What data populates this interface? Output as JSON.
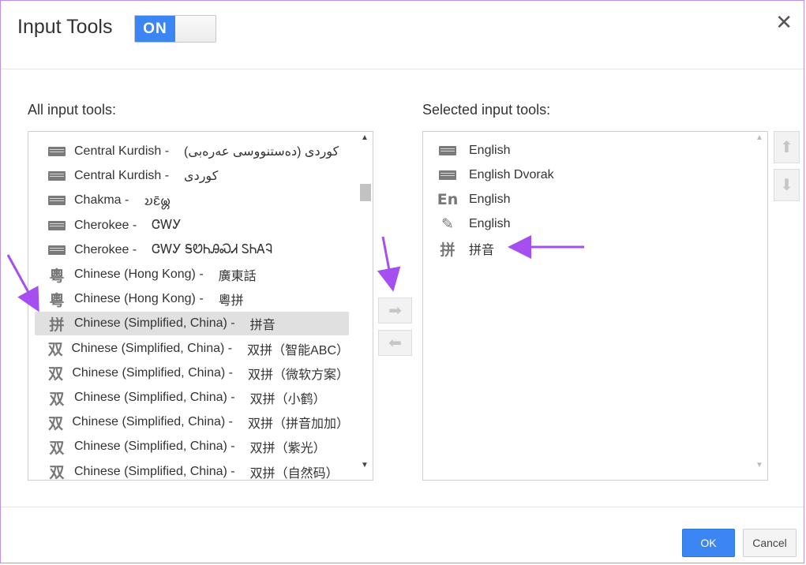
{
  "dialog": {
    "title": "Input Tools",
    "toggle_label": "ON",
    "close_glyph": "✕"
  },
  "left": {
    "label": "All input tools:",
    "items": [
      {
        "icon": "keyboard-icon",
        "name": "Central Kurdish -",
        "native": "کوردی (دەستنووسی عەرەبی)"
      },
      {
        "icon": "keyboard-icon",
        "name": "Central Kurdish -",
        "native": "کوردی"
      },
      {
        "icon": "keyboard-icon",
        "name": "Chakma -",
        "native": "𑄌𑄋𑄴𑄟𑄳𑄦"
      },
      {
        "icon": "keyboard-icon",
        "name": "Cherokee -",
        "native": "ᏣᎳᎩ"
      },
      {
        "icon": "keyboard-icon",
        "name": "Cherokee -",
        "native": "ᏣᎳᎩ ᎦᏬᏂᎯᏍᏗ ᏚᏂᎪᎸ"
      },
      {
        "icon": "yue-icon",
        "glyph": "粵",
        "name": "Chinese (Hong Kong) -",
        "native": "廣東話"
      },
      {
        "icon": "yue-icon",
        "glyph": "粵",
        "name": "Chinese (Hong Kong) -",
        "native": "粵拼"
      },
      {
        "icon": "pinyin-icon",
        "glyph": "拼",
        "name": "Chinese (Simplified, China) -",
        "native": "拼音",
        "selected": true
      },
      {
        "icon": "shuangpin-icon",
        "glyph": "双",
        "name": "Chinese (Simplified, China) -",
        "native": "双拼（智能ABC）"
      },
      {
        "icon": "shuangpin-icon",
        "glyph": "双",
        "name": "Chinese (Simplified, China) -",
        "native": "双拼（微软方案）"
      },
      {
        "icon": "shuangpin-icon",
        "glyph": "双",
        "name": "Chinese (Simplified, China) -",
        "native": "双拼（小鹤）"
      },
      {
        "icon": "shuangpin-icon",
        "glyph": "双",
        "name": "Chinese (Simplified, China) -",
        "native": "双拼（拼音加加）"
      },
      {
        "icon": "shuangpin-icon",
        "glyph": "双",
        "name": "Chinese (Simplified, China) -",
        "native": "双拼（紫光）"
      },
      {
        "icon": "shuangpin-icon",
        "glyph": "双",
        "name": "Chinese (Simplified, China) -",
        "native": "双拼（自然码）"
      }
    ]
  },
  "right": {
    "label": "Selected input tools:",
    "items": [
      {
        "icon": "keyboard-icon",
        "name": "English"
      },
      {
        "icon": "keyboard-icon",
        "name": "English Dvorak"
      },
      {
        "icon": "transliteration-icon",
        "glyph": "En",
        "name": "English"
      },
      {
        "icon": "pencil-icon",
        "glyph": "✎",
        "name": "English"
      },
      {
        "icon": "pinyin-icon",
        "glyph": "拼",
        "name": "拼音"
      }
    ]
  },
  "buttons": {
    "ok": "OK",
    "cancel": "Cancel"
  },
  "colors": {
    "accent": "#3b86f2",
    "annotation": "#a64ff0"
  }
}
